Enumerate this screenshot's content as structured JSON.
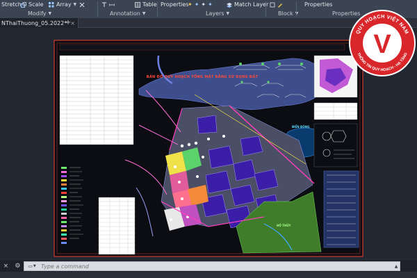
{
  "ribbon": {
    "modify": {
      "stretch": "Stretch",
      "scale": "Scale",
      "array": "Array",
      "label": "Modify"
    },
    "annotation": {
      "table": "Table",
      "label": "Annotation"
    },
    "layers": {
      "properties": "Properties",
      "match_layer": "Match Layer",
      "label": "Layers"
    },
    "block": {
      "label": "Block"
    },
    "properties": {
      "properties": "Properties",
      "label": "Properties"
    }
  },
  "tabs": {
    "drawing": "NThaiThuong_05.2022*",
    "new_tab": "+"
  },
  "drawing": {
    "title": "BẢN ĐỒ QUY HOẠCH TỔNG MẶT BẰNG SỬ DỤNG ĐẤT",
    "annotation_river": "BIỂN ĐÔNG",
    "annotation_lake": "HỒ THỦY"
  },
  "logo": {
    "letter": "V",
    "top_text": "QUY HOẠCH VIỆT NAM",
    "bottom_text": "THÔNG TIN QUY HOẠCH - HẠ TẦNG"
  },
  "command": {
    "placeholder": "Type a command"
  },
  "colors": {
    "ribbon_bg": "#3b4453",
    "canvas_bg": "#212832",
    "sheet_border": "#d43a2e",
    "brand_red": "#d9262a"
  }
}
